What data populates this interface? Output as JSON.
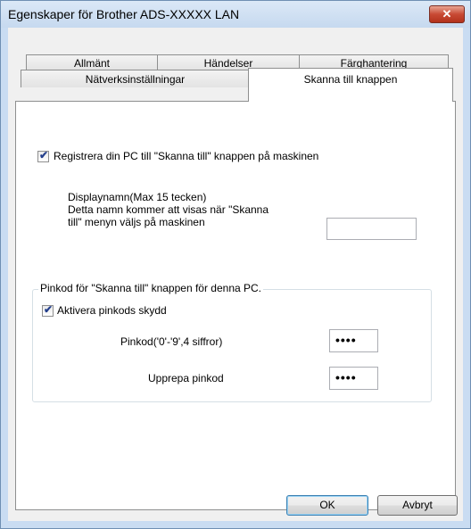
{
  "window": {
    "title": "Egenskaper för Brother ADS-XXXXX LAN",
    "close_glyph": "✕"
  },
  "tabs": {
    "row1": [
      "Allmänt",
      "Händelser",
      "Färghantering"
    ],
    "row2": [
      "Nätverksinställningar",
      "Skanna till knappen"
    ],
    "active": "Skanna till knappen"
  },
  "register": {
    "label": "Registrera din PC till \"Skanna till\" knappen på maskinen",
    "checked": true
  },
  "display_name": {
    "line1": "Displaynamn(Max 15 tecken)",
    "line2": "Detta namn kommer att visas när \"Skanna",
    "line3": "till\" menyn väljs på maskinen",
    "value": ""
  },
  "pin_group": {
    "legend": "Pinkod för \"Skanna till\" knappen för denna PC.",
    "enable_label": "Aktivera pinkods skydd",
    "enable_checked": true,
    "pin_label": "Pinkod('0'-'9',4 siffror)",
    "pin_value": "••••",
    "repeat_label": "Upprepa pinkod",
    "repeat_value": "••••"
  },
  "buttons": {
    "ok": "OK",
    "cancel": "Avbryt"
  },
  "icons": {
    "check": "✔"
  }
}
